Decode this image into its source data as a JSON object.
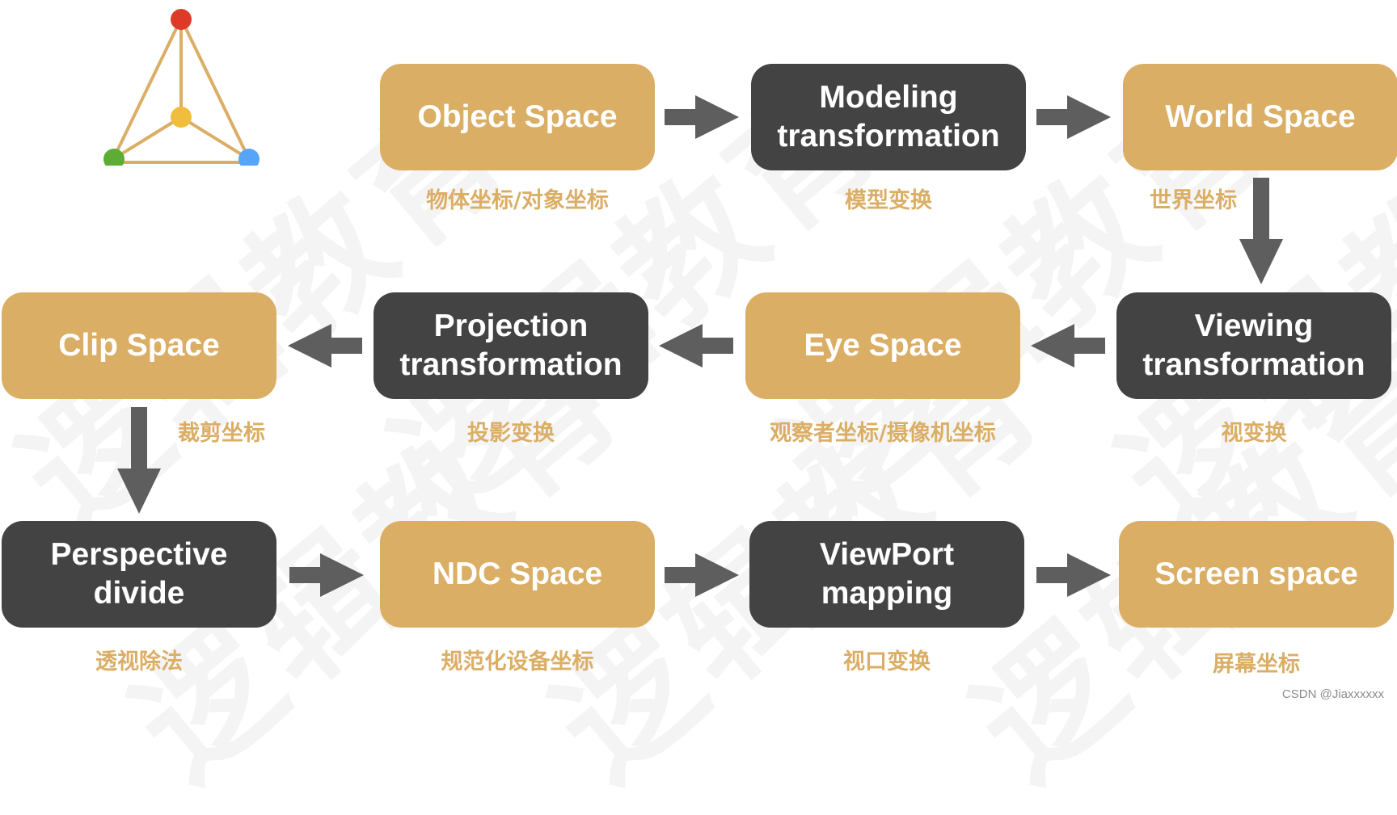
{
  "diagram": {
    "title_graphic": "tetrahedron-icon",
    "colors": {
      "space_box": "#dbae66",
      "transform_box": "#434343",
      "arrow": "#5e5e5e",
      "caption": "#dbae66",
      "text": "#ffffff",
      "vertex_top": "#dd3b27",
      "vertex_center": "#f0bd3e",
      "vertex_left": "#5bad33",
      "vertex_right": "#57a5fb",
      "edge": "#dbae66"
    },
    "nodes": [
      {
        "id": "object-space",
        "label": "Object Space",
        "caption": "物体坐标/对象坐标",
        "kind": "space"
      },
      {
        "id": "modeling-transformation",
        "label": "Modeling\ntransformation",
        "caption": "模型变换",
        "kind": "transform"
      },
      {
        "id": "world-space",
        "label": "World Space",
        "caption": "世界坐标",
        "kind": "space"
      },
      {
        "id": "viewing-transformation",
        "label": "Viewing\ntransformation",
        "caption": "视变换",
        "kind": "transform"
      },
      {
        "id": "eye-space",
        "label": "Eye Space",
        "caption": "观察者坐标/摄像机坐标",
        "kind": "space"
      },
      {
        "id": "projection-transformation",
        "label": "Projection\ntransformation",
        "caption": "投影变换",
        "kind": "transform"
      },
      {
        "id": "clip-space",
        "label": "Clip Space",
        "caption": "裁剪坐标",
        "kind": "space"
      },
      {
        "id": "perspective-divide",
        "label": "Perspective\ndivide",
        "caption": "透视除法",
        "kind": "transform"
      },
      {
        "id": "ndc-space",
        "label": "NDC Space",
        "caption": "规范化设备坐标",
        "kind": "space"
      },
      {
        "id": "viewport-mapping",
        "label": "ViewPort\nmapping",
        "caption": "视口变换",
        "kind": "transform"
      },
      {
        "id": "screen-space",
        "label": "Screen space",
        "caption": "屏幕坐标",
        "kind": "space"
      }
    ],
    "edges": [
      {
        "from": "object-space",
        "to": "modeling-transformation",
        "direction": "right"
      },
      {
        "from": "modeling-transformation",
        "to": "world-space",
        "direction": "right"
      },
      {
        "from": "world-space",
        "to": "viewing-transformation",
        "direction": "down"
      },
      {
        "from": "viewing-transformation",
        "to": "eye-space",
        "direction": "left"
      },
      {
        "from": "eye-space",
        "to": "projection-transformation",
        "direction": "left"
      },
      {
        "from": "projection-transformation",
        "to": "clip-space",
        "direction": "left"
      },
      {
        "from": "clip-space",
        "to": "perspective-divide",
        "direction": "down"
      },
      {
        "from": "perspective-divide",
        "to": "ndc-space",
        "direction": "right"
      },
      {
        "from": "ndc-space",
        "to": "viewport-mapping",
        "direction": "right"
      },
      {
        "from": "viewport-mapping",
        "to": "screen-space",
        "direction": "right"
      }
    ],
    "watermark_text": "逻辑教育",
    "footer": "CSDN @Jiaxxxxxx"
  }
}
